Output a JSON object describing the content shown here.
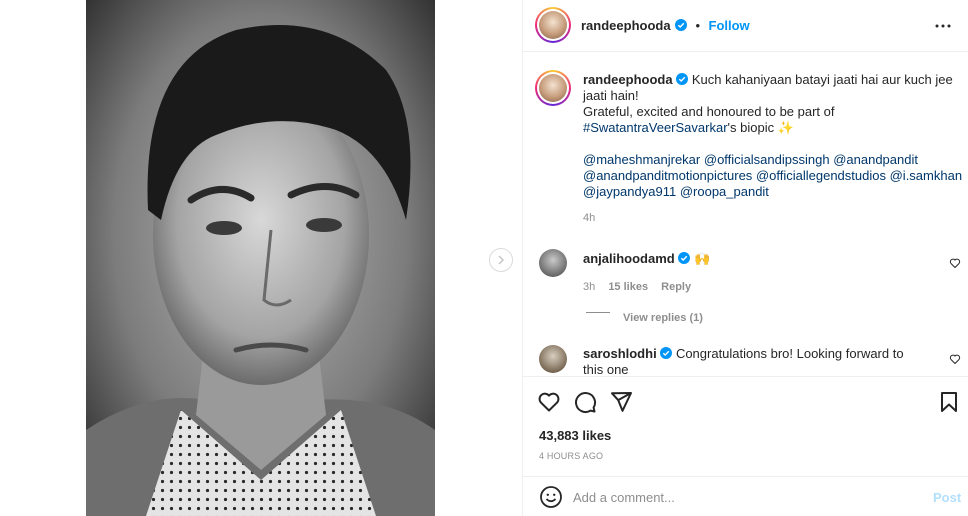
{
  "post": {
    "author": "randeephooda",
    "follow_label": "Follow",
    "dot": "•",
    "caption": {
      "line1": "Kuch kahaniyaan batayi jaati hai aur kuch jee jaati hain!",
      "line2": "Grateful, excited and honoured to be part of",
      "hashtag": "#SwatantraVeerSavarkar",
      "line3_suffix": "'s biopic",
      "mentions": [
        "@maheshmanjrekar",
        "@officialsandipssingh",
        "@anandpandit",
        "@anandpanditmotionpictures",
        "@officiallegendstudios",
        "@i.samkhan",
        "@jaypandya911",
        "@roopa_pandit"
      ],
      "time": "4h"
    },
    "comments": [
      {
        "user": "anjalihoodamd",
        "emoji": "🙌",
        "time": "3h",
        "likes": "15 likes",
        "reply": "Reply",
        "view_replies": "View replies (1)"
      },
      {
        "user": "saroshlodhi",
        "text": "Congratulations bro! Looking forward to this one"
      }
    ],
    "likes": "43,883 likes",
    "posted_ago": "4 HOURS AGO",
    "comment_placeholder": "Add a comment...",
    "post_label": "Post"
  },
  "colors": {
    "accent": "#0095f6",
    "link": "#00376b",
    "muted": "#8e8e8e",
    "border": "#efefef"
  },
  "icons": {
    "verified": "verified-badge-icon",
    "more": "more-options-icon",
    "like": "heart-icon",
    "comment": "comment-bubble-icon",
    "share": "paper-plane-icon",
    "save": "bookmark-icon",
    "emoji": "smiley-icon",
    "next": "chevron-right-icon"
  }
}
